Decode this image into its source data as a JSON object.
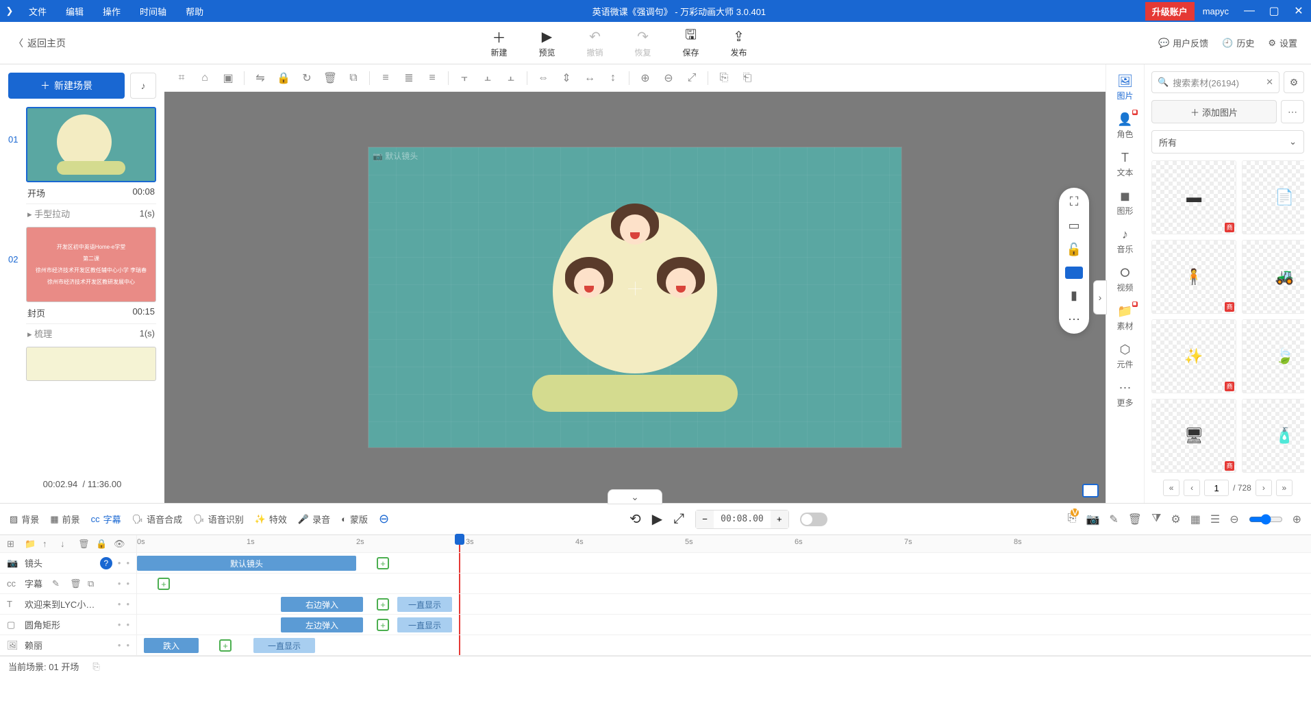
{
  "title": "英语微课《强调句》 - 万彩动画大师 3.0.401",
  "menus": [
    "文件",
    "编辑",
    "操作",
    "时间轴",
    "帮助"
  ],
  "upgrade": "升级账户",
  "user": "mapyc",
  "back": "返回主页",
  "toolbar": [
    {
      "icon": "＋",
      "label": "新建",
      "disabled": false
    },
    {
      "icon": "▶",
      "label": "预览",
      "disabled": false
    },
    {
      "icon": "↶",
      "label": "撤销",
      "disabled": true
    },
    {
      "icon": "↷",
      "label": "恢复",
      "disabled": true
    },
    {
      "icon": "🖫",
      "label": "保存",
      "disabled": false
    },
    {
      "icon": "⇪",
      "label": "发布",
      "disabled": false
    }
  ],
  "righttools": [
    {
      "icon": "💬",
      "label": "用户反馈"
    },
    {
      "icon": "🕘",
      "label": "历史"
    },
    {
      "icon": "⚙",
      "label": "设置"
    }
  ],
  "newscene": "新建场景",
  "scenes": [
    {
      "num": "01",
      "name": "开场",
      "dur": "00:08",
      "trans": "手型拉动",
      "transDur": "1(s)",
      "sel": true
    },
    {
      "num": "02",
      "name": "封页",
      "dur": "00:15",
      "trans": "梳理",
      "transDur": "1(s)",
      "sel": false,
      "lines": [
        "开发区初中英语Home-e学堂",
        "第二课",
        "徐州市经济技术开发区教任辅中心小学 李瑞春",
        "徐州市经济技术开发区教研发展中心"
      ]
    }
  ],
  "timecounter": {
    "cur": "00:02.94",
    "total": "11:36.00"
  },
  "sidetabs": [
    {
      "icon": "🖼",
      "label": "图片",
      "active": true
    },
    {
      "icon": "👤",
      "label": "角色",
      "badge": true
    },
    {
      "icon": "T",
      "label": "文本"
    },
    {
      "icon": "◼",
      "label": "图形"
    },
    {
      "icon": "♪",
      "label": "音乐"
    },
    {
      "icon": "⭘",
      "label": "视频"
    },
    {
      "icon": "📁",
      "label": "素材",
      "badge": true
    },
    {
      "icon": "⬡",
      "label": "元件"
    },
    {
      "icon": "⋯",
      "label": "更多"
    }
  ],
  "search_placeholder": "搜索素材(26194)",
  "addimg": "添加图片",
  "category": "所有",
  "tiles_tag": "商",
  "pager": {
    "page": "1",
    "total": "728"
  },
  "tlmodes": [
    {
      "icon": "▨",
      "label": "背景"
    },
    {
      "icon": "▦",
      "label": "前景"
    },
    {
      "icon": "cc",
      "label": "字幕",
      "active": true
    },
    {
      "icon": "🗣",
      "label": "语音合成"
    },
    {
      "icon": "🗣",
      "label": "语音识别"
    },
    {
      "icon": "✨",
      "label": "特效"
    },
    {
      "icon": "🎤",
      "label": "录音"
    },
    {
      "icon": "◐",
      "label": "蒙版"
    }
  ],
  "timecode": "00:08.00",
  "ruler": [
    "0s",
    "1s",
    "2s",
    "3s",
    "4s",
    "5s",
    "6s",
    "7s",
    "8s"
  ],
  "tracks": {
    "camera": {
      "label": "镜头",
      "clip": "默认镜头"
    },
    "subtitle": {
      "label": "字幕"
    },
    "text": {
      "label": "欢迎来到LYC小课堂",
      "clip1": "右边弹入",
      "clip2": "一直显示"
    },
    "shape": {
      "label": "圆角矩形",
      "clip1": "左边弹入",
      "clip2": "一直显示"
    },
    "img": {
      "label": "赖丽",
      "clip1": "跌入",
      "clip2": "一直显示"
    }
  },
  "status": {
    "label": "当前场景:",
    "value": "01  开场"
  }
}
